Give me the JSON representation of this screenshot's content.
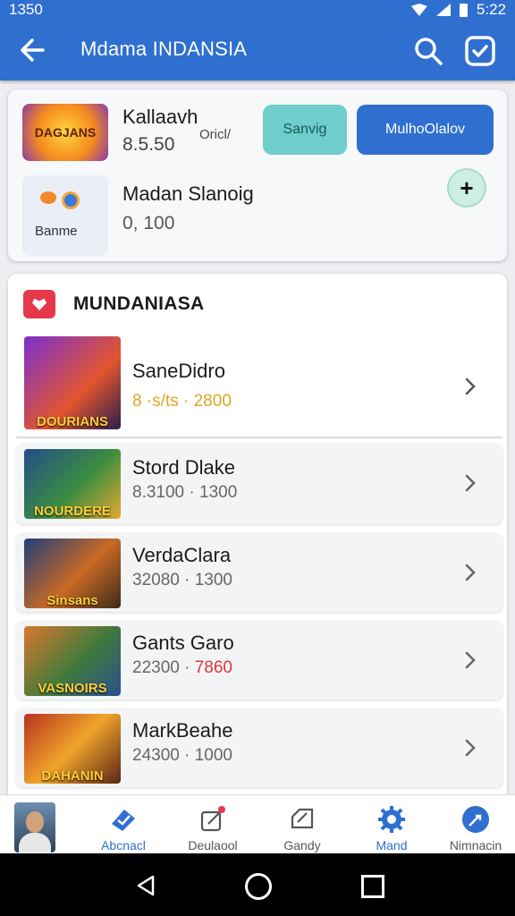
{
  "status_bar": {
    "time": "1350",
    "clock": "5:22"
  },
  "app_bar": {
    "title": "Mdama INDANSIA"
  },
  "summary": {
    "row1": {
      "logo_text": "DAGJANS",
      "name": "Kallaavh",
      "price": "8.5.50",
      "tag": "Oricl/",
      "button_teal": "Sanvig",
      "button_blue": "MulhoOlalov"
    },
    "row2": {
      "logo_label": "Banme",
      "name": "Madan Slanoig",
      "price": "0, 100"
    }
  },
  "section": {
    "title": "MUNDANIASA"
  },
  "items": [
    {
      "thumb_text": "DOURIANS",
      "name": "SaneDidro",
      "price": "8 ·s/ts · 2800"
    },
    {
      "thumb_text": "NOURDERE",
      "name": "Stord Dlake",
      "price": "8.3100 · 1300"
    },
    {
      "thumb_text": "Sinsans",
      "name": "VerdaClara",
      "price": "32080 · 1300"
    },
    {
      "thumb_text": "VASNOIRS",
      "name": "Gants Garo",
      "price_base": "22300 · ",
      "price_accent": "7860"
    },
    {
      "thumb_text": "DAHANIN",
      "name": "MarkBeahe",
      "price": "24300 · 1000"
    }
  ],
  "bottom_nav": [
    {
      "label": "Abcnacl"
    },
    {
      "label": "Deulaool"
    },
    {
      "label": "Gandy"
    },
    {
      "label": "Mand"
    },
    {
      "label": "Nimnacin"
    }
  ],
  "colors": {
    "primary": "#2f6fd0",
    "teal": "#6fcdcb",
    "gold": "#e0a526",
    "red_accent": "#d63a3a"
  }
}
